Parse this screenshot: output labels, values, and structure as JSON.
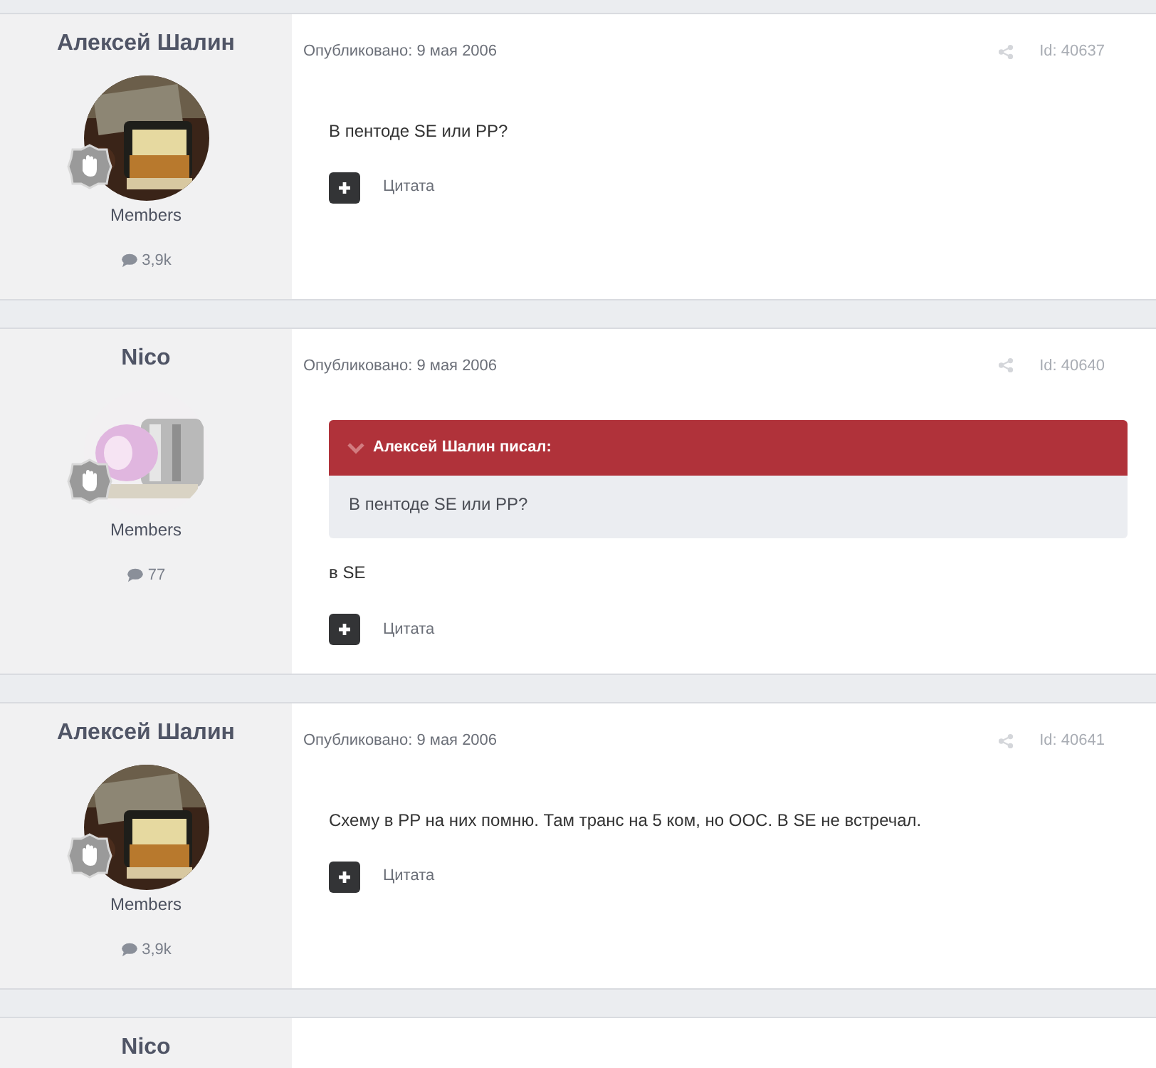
{
  "posts": [
    {
      "author": "Алексей Шалин",
      "group": "Members",
      "post_count": "3,9k",
      "date": "Опубликовано: 9 мая 2006",
      "post_id": "Id: 40637",
      "body": "В пентоде SE или PP?",
      "quote_button": "Цитата"
    },
    {
      "author": "Nico",
      "group": "Members",
      "post_count": "77",
      "date": "Опубликовано: 9 мая 2006",
      "post_id": "Id: 40640",
      "quote": {
        "header": "Алексей Шалин писал:",
        "text": "В пентоде SE или PP?"
      },
      "body": "в SE",
      "quote_button": "Цитата"
    },
    {
      "author": "Алексей Шалин",
      "group": "Members",
      "post_count": "3,9k",
      "date": "Опубликовано: 9 мая 2006",
      "post_id": "Id: 40641",
      "body": "Схему в PP на них помню. Там транс на 5 ком, но ООС. В SE не встречал.",
      "quote_button": "Цитата"
    }
  ],
  "next_post": {
    "author": "Nico"
  }
}
